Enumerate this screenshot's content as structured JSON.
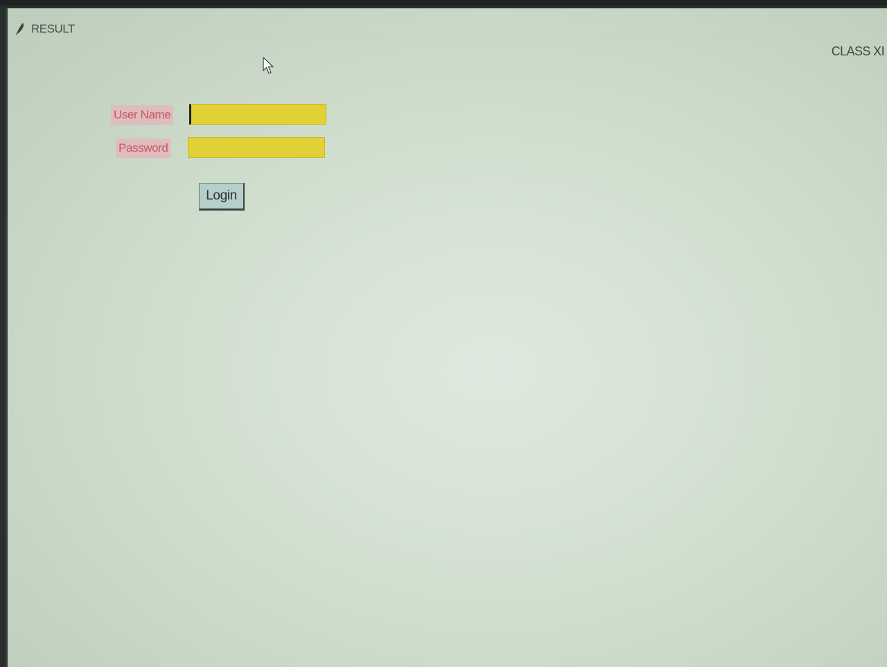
{
  "window": {
    "title": "RESULT",
    "icon": "feather-icon"
  },
  "header": {
    "class_label": "CLASS XI"
  },
  "form": {
    "username_label": "User Name",
    "username_value": "",
    "password_label": "Password",
    "password_value": "",
    "login_label": "Login"
  },
  "colors": {
    "background": "#d1dfcf",
    "label_bg": "#e0bcbc",
    "label_text": "#c55a64",
    "entry_bg": "#e2d135",
    "button_bg": "#b5cfcb"
  },
  "pointer": {
    "icon": "mouse-cursor-icon"
  }
}
